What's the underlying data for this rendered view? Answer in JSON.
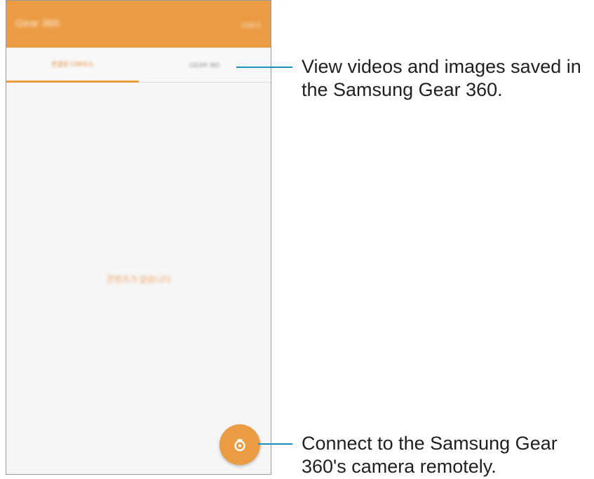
{
  "app": {
    "title": "Gear 360",
    "action": "더보기"
  },
  "tabs": [
    {
      "label": "연결된 디바이스",
      "selected": true
    },
    {
      "label": "GEAR 360",
      "selected": false
    }
  ],
  "main": {
    "empty_message": "콘텐츠가 없습니다"
  },
  "fab": {
    "icon": "camera-icon"
  },
  "callouts": [
    {
      "lines": [
        "View videos and images saved in",
        "the Samsung Gear 360."
      ]
    },
    {
      "lines": [
        "Connect to the Samsung Gear",
        "360's camera remotely."
      ]
    }
  ],
  "colors": {
    "accent": "#eb9b42",
    "callout_line": "#1a8fc4",
    "background": "#f6f6f6"
  }
}
